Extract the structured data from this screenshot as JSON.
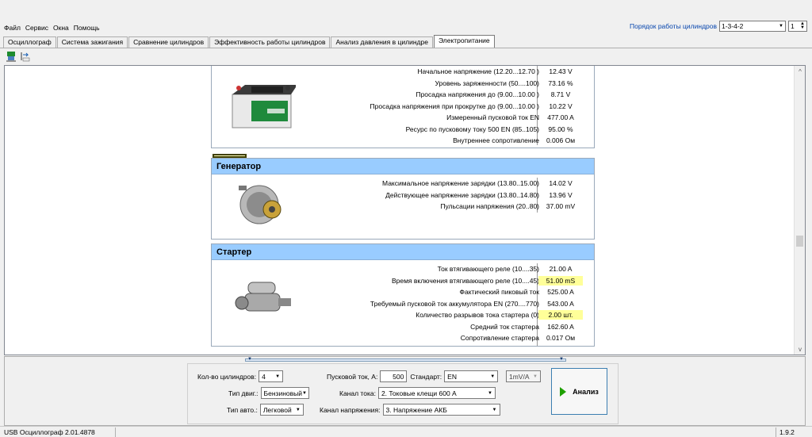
{
  "menu": [
    "Файл",
    "Сервис",
    "Окна",
    "Помощь"
  ],
  "cylinder_order": {
    "label": "Порядок работы цилиндров",
    "value": "1-3-4-2",
    "spin": "1"
  },
  "tabs": [
    "Осциллограф",
    "Система зажигания",
    "Сравнение цилиндров",
    "Эффективность работы цилиндров",
    "Анализ давления в цилиндре",
    "Электропитание"
  ],
  "battery": {
    "rows": [
      {
        "label": "Начальное напряжение (12.20...12.70 )",
        "value": "12.43 V",
        "highlight": false
      },
      {
        "label": "Уровень заряженности (50....100)",
        "value": "73.16 %",
        "highlight": false
      },
      {
        "label": "Просадка напряжения до (9.00...10.00 )",
        "value": "8.71 V",
        "highlight": false
      },
      {
        "label": "Просадка напряжения при прокрутке до (9.00...10.00 )",
        "value": "10.22 V",
        "highlight": false
      },
      {
        "label": "Измеренный пусковой ток EN",
        "value": "477.00 A",
        "highlight": false
      },
      {
        "label": "Ресурс по пусковому току 500 EN (85..105)",
        "value": "95.00 %",
        "highlight": false
      },
      {
        "label": "Внутреннее сопротивление",
        "value": "0.006 Ом",
        "highlight": false
      }
    ]
  },
  "generator": {
    "title": "Генератор",
    "rows": [
      {
        "label": "Максимальное напряжение зарядки (13.80..15.00)",
        "value": "14.02 V",
        "highlight": false
      },
      {
        "label": "Действующее напряжение зарядки (13.80..14.80)",
        "value": "13.96 V",
        "highlight": false
      },
      {
        "label": "Пульсации напряжения (20..80)",
        "value": "37.00 mV",
        "highlight": false
      }
    ]
  },
  "starter": {
    "title": "Стартер",
    "rows": [
      {
        "label": "Ток втягивающего реле (10....35)",
        "value": "21.00 A",
        "highlight": false
      },
      {
        "label": "Время включения втягивающего реле (10....45)",
        "value": "51.00 mS",
        "highlight": true
      },
      {
        "label": "Фактический пиковый ток",
        "value": "525.00 A",
        "highlight": false
      },
      {
        "label": "Требуемый пусковой ток аккумулятора EN (270....770)",
        "value": "543.00 A",
        "highlight": false
      },
      {
        "label": "Количество разрывов тока стартера (0)",
        "value": "2.00 шт.",
        "highlight": true
      },
      {
        "label": "Средний ток стартера",
        "value": "162.60 A",
        "highlight": false
      },
      {
        "label": "Сопротивление стартера",
        "value": "0.017 Ом",
        "highlight": false
      }
    ]
  },
  "controls": {
    "cyl_count_label": "Кол-во цилиндров:",
    "cyl_count": "4",
    "engine_type_label": "Тип двиг.:",
    "engine_type": "Бензиновый",
    "car_type_label": "Тип авто.:",
    "car_type": "Легковой",
    "start_current_label": "Пусковой ток, А:",
    "start_current": "500",
    "standard_label": "Стандарт:",
    "standard": "EN",
    "current_channel_label": "Канал тока:",
    "current_channel": "2. Токовые клещи 600 A",
    "voltage_channel_label": "Канал напряжения:",
    "voltage_channel": "3. Напряжение АКБ",
    "scale": "1mV/A",
    "analyze": "Анализ"
  },
  "status": {
    "app": "USB Осциллограф 2.01.4878",
    "version": "1.9.2"
  }
}
